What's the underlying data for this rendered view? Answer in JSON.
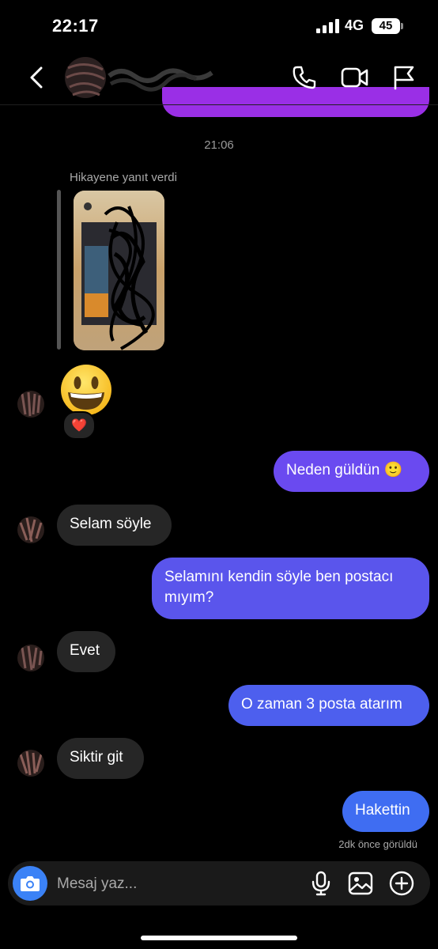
{
  "status_bar": {
    "time": "22:17",
    "network": "4G",
    "battery": "45"
  },
  "header": {
    "back_icon": "chevron-left-icon",
    "call_icon": "phone-icon",
    "video_icon": "video-camera-icon",
    "report_icon": "flag-icon"
  },
  "colors": {
    "background": "#000000",
    "incoming_bubble": "#262626",
    "outgoing_gradient_top": "#7a3ff0",
    "outgoing_gradient_bottom": "#3f6df2",
    "accent_blue": "#3b82f6"
  },
  "chat": {
    "timestamp": "21:06",
    "story_reply_label": "Hikayene yanıt verdi",
    "reaction_emoji": "❤️",
    "messages": [
      {
        "from": "me",
        "text": "Neden güldün 🙂"
      },
      {
        "from": "them",
        "text": "Selam söyle"
      },
      {
        "from": "me",
        "text": "Selamını kendin söyle ben postacı mıyım?"
      },
      {
        "from": "them",
        "text": "Evet"
      },
      {
        "from": "me",
        "text": "O zaman 3 posta atarım"
      },
      {
        "from": "them",
        "text": "Siktir git"
      },
      {
        "from": "me",
        "text": "Hakettin"
      }
    ],
    "seen_status": "2dk önce görüldü"
  },
  "composer": {
    "placeholder": "Mesaj yaz...",
    "camera_icon": "camera-icon",
    "mic_icon": "microphone-icon",
    "gallery_icon": "image-icon",
    "plus_icon": "plus-circle-icon"
  }
}
